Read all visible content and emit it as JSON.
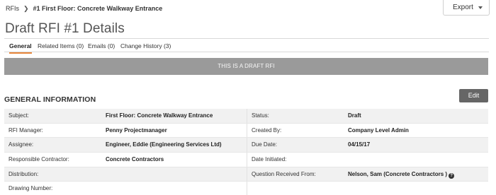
{
  "breadcrumb": {
    "root": "RFIs",
    "current": "#1 First Floor: Concrete Walkway Entrance"
  },
  "toolbar": {
    "export_label": "Export"
  },
  "page_title": "Draft RFI #1 Details",
  "tabs": [
    {
      "label": "General",
      "active": true
    },
    {
      "label": "Related Items (0)",
      "active": false
    },
    {
      "label": "Emails (0)",
      "active": false
    },
    {
      "label": "Change History (3)",
      "active": false
    }
  ],
  "banner": "THIS IS A DRAFT RFI",
  "section": {
    "title": "GENERAL INFORMATION",
    "edit_label": "Edit"
  },
  "rows": [
    {
      "label1": "Subject:",
      "value1": "First Floor: Concrete Walkway Entrance",
      "label2": "Status:",
      "value2": "Draft"
    },
    {
      "label1": "RFI Manager:",
      "value1": "Penny Projectmanager",
      "label2": "Created By:",
      "value2": "Company Level Admin"
    },
    {
      "label1": "Assignee:",
      "value1": "Engineer, Eddie (Engineering Services Ltd)",
      "label2": "Due Date:",
      "value2": "04/15/17"
    },
    {
      "label1": "Responsible Contractor:",
      "value1": "Concrete Contractors",
      "label2": "Date Initiated:",
      "value2": ""
    },
    {
      "label1": "Distribution:",
      "value1": "",
      "label2": "Question Received From:",
      "value2": "Nelson, Sam (Concrete Contractors )"
    },
    {
      "label1": "Drawing Number:",
      "value1": "",
      "label2": "",
      "value2": ""
    }
  ],
  "colors": {
    "accent": "#e8863a",
    "banner_bg": "#9a9a9a",
    "edit_bg": "#666666"
  }
}
